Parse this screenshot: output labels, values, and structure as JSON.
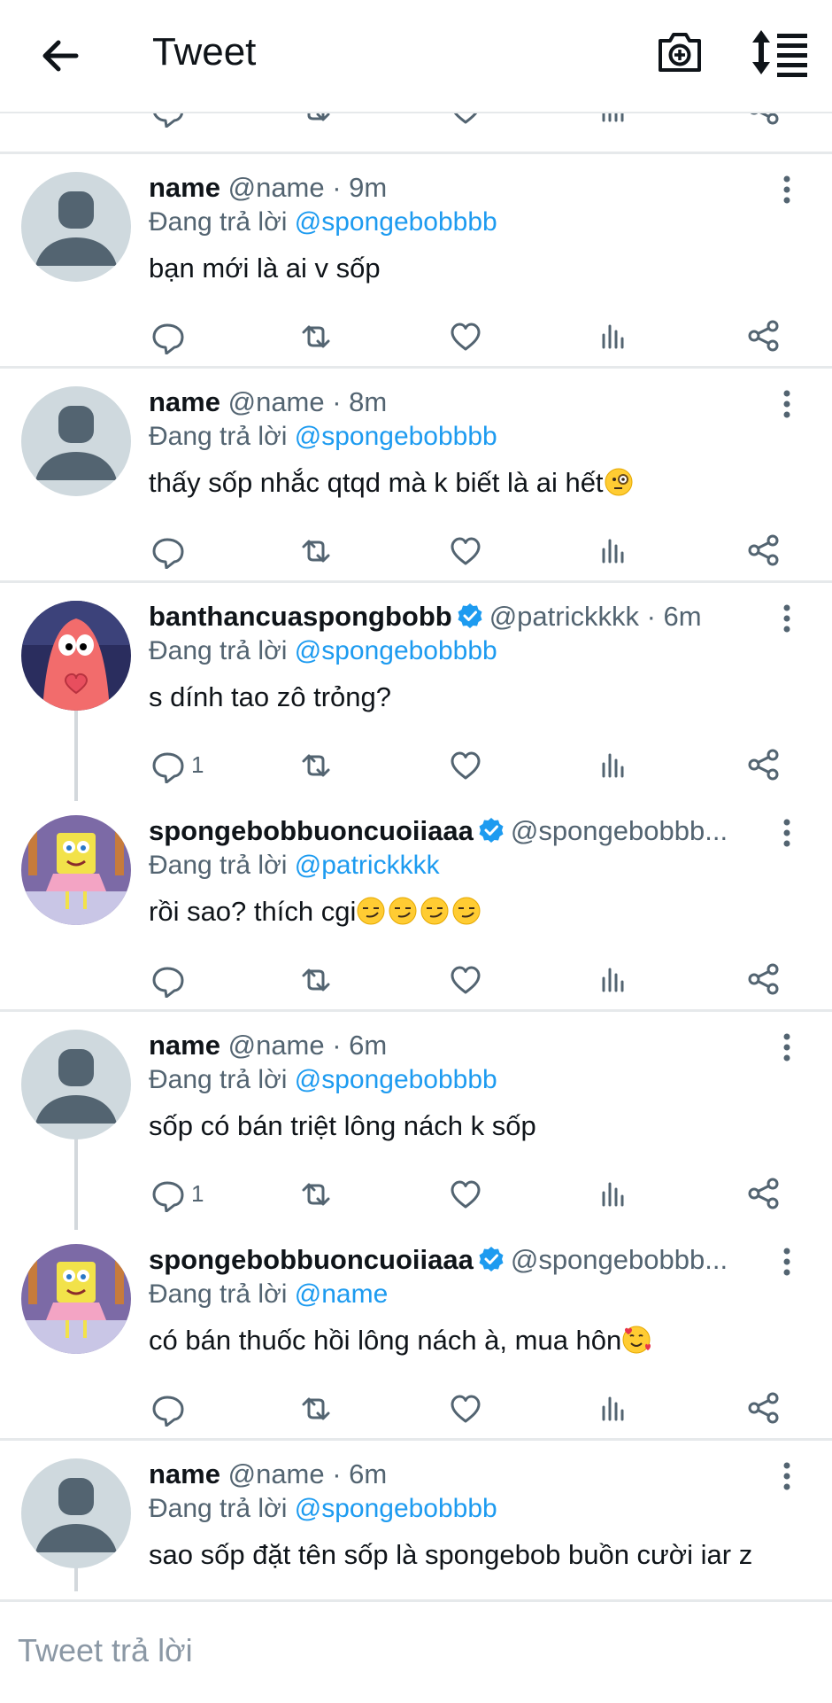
{
  "header": {
    "title": "Tweet",
    "back_icon": "arrow-left-icon",
    "camera_icon": "camera-plus-icon",
    "sort_icon": "sort-icon"
  },
  "colors": {
    "link": "#1d9bf0",
    "muted": "#536471",
    "separator": "#e6e9eb",
    "verified": "#1d9bf0"
  },
  "tweets": [
    {
      "name": "name",
      "handle": "@name",
      "time": "· 9m",
      "reply_label": "Đang trả lời",
      "reply_to": "@spongebobbbb",
      "text": "bạn mới là ai v sốp",
      "reply_count": "",
      "verified": false,
      "avatar": "default"
    },
    {
      "name": "name",
      "handle": "@name",
      "time": "· 8m",
      "reply_label": "Đang trả lời",
      "reply_to": "@spongebobbbb",
      "text": "thấy sốp nhắc qtqd mà k biết là ai hết",
      "emoji": [
        "monocle-face"
      ],
      "reply_count": "",
      "verified": false,
      "avatar": "default"
    },
    {
      "name": "banthancuaspongbobb",
      "handle": "@patrickkkk",
      "time": "· 6m",
      "reply_label": "Đang trả lời",
      "reply_to": "@spongebobbbb",
      "text": "s dính tao zô trỏng?",
      "reply_count": "1",
      "verified": true,
      "avatar": "patrick"
    },
    {
      "name": "spongebobbuoncuoiiaaa",
      "handle": "@spongebobbb...",
      "time": "",
      "reply_label": "Đang trả lời",
      "reply_to": "@patrickkkk",
      "text": "rồi sao? thích cgi",
      "emoji": [
        "smirk",
        "smirk",
        "smirk",
        "smirk"
      ],
      "reply_count": "",
      "verified": true,
      "avatar": "spongebob"
    },
    {
      "name": "name",
      "handle": "@name",
      "time": "· 6m",
      "reply_label": "Đang trả lời",
      "reply_to": "@spongebobbbb",
      "text": "sốp có bán triệt lông nách k sốp",
      "reply_count": "1",
      "verified": false,
      "avatar": "default"
    },
    {
      "name": "spongebobbuoncuoiiaaa",
      "handle": "@spongebobbb...",
      "time": "",
      "reply_label": "Đang trả lời",
      "reply_to": "@name",
      "text": "có bán thuốc hồi lông nách à, mua hôn",
      "emoji": [
        "smiling-face-with-hearts"
      ],
      "reply_count": "",
      "verified": true,
      "avatar": "spongebob"
    },
    {
      "name": "name",
      "handle": "@name",
      "time": "· 6m",
      "reply_label": "Đang trả lời",
      "reply_to": "@spongebobbbb",
      "text": "sao sốp đặt tên sốp là spongebob buồn cười iar z",
      "reply_count": "",
      "verified": false,
      "avatar": "default"
    }
  ],
  "composer": {
    "placeholder": "Tweet trả lời"
  }
}
